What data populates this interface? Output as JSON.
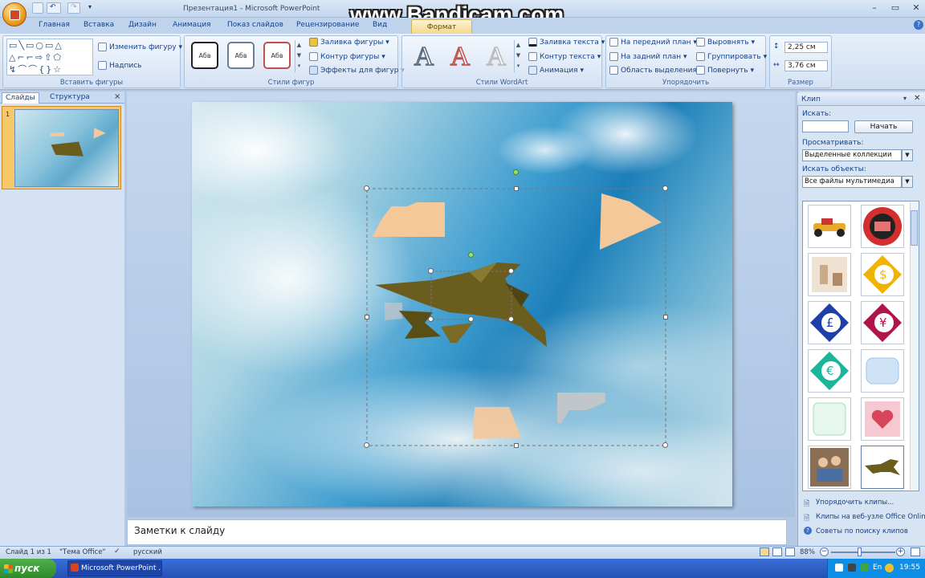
{
  "window": {
    "title": "Презентация1 - Microsoft PowerPoint"
  },
  "watermark": {
    "text": "www.Bandicam.com"
  },
  "tabs": [
    "Главная",
    "Вставка",
    "Дизайн",
    "Анимация",
    "Показ слайдов",
    "Рецензирование",
    "Вид"
  ],
  "active_tab": "Формат",
  "ribbon": {
    "insert_shapes": {
      "label": "Вставить фигуры",
      "change_shape": "Изменить фигуру",
      "textbox": "Надпись"
    },
    "shape_styles": {
      "label": "Стили фигур",
      "style_sample": "Абв",
      "fill": "Заливка фигуры",
      "outline": "Контур фигуры",
      "effects": "Эффекты для фигур"
    },
    "wordart": {
      "label": "Стили WordArt",
      "glyph": "A",
      "fill": "Заливка текста",
      "outline": "Контур текста",
      "animation": "Анимация"
    },
    "arrange": {
      "label": "Упорядочить",
      "front": "На передний план",
      "back": "На задний план",
      "pane": "Область выделения",
      "align": "Выровнять",
      "group": "Группировать",
      "rotate": "Повернуть"
    },
    "size": {
      "label": "Размер",
      "height": "2,25 см",
      "width": "3,76 см"
    }
  },
  "left_pane": {
    "tab_slides": "Слайды",
    "tab_outline": "Структура",
    "slide_number": "1",
    "close": "×"
  },
  "notes": {
    "placeholder": "Заметки к слайду"
  },
  "clip_pane": {
    "title": "Клип",
    "search_label": "Искать:",
    "search_value": "",
    "go_button": "Начать",
    "browse_label": "Просматривать:",
    "browse_value": "Выделенные коллекции",
    "find_label": "Искать объекты:",
    "find_value": "Все файлы мультимедиа",
    "links": [
      "Упорядочить клипы...",
      "Клипы на веб-узле Office Online",
      "Советы по поиску клипов"
    ]
  },
  "statusbar": {
    "slide": "Слайд 1 из 1",
    "theme": "\"Тема Office\"",
    "language": "русский",
    "zoom": "88%"
  },
  "zoom_level": 88,
  "taskbar": {
    "start": "пуск",
    "item": "Microsoft PowerPoint ...",
    "lang": "En",
    "time": "19:55"
  },
  "colors": {
    "accent": "#f5d98a",
    "ribbon": "#dce8f7",
    "shape_fill": "#f5c89a",
    "plane": "#6b5d1e"
  }
}
